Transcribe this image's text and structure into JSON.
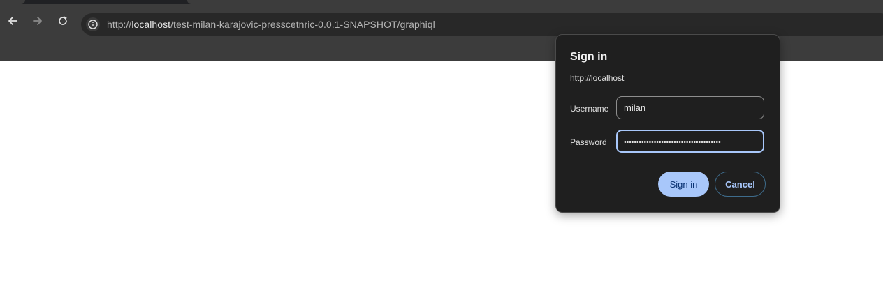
{
  "browser": {
    "url_scheme": "http://",
    "url_host": "localhost",
    "url_path": "/test-milan-karajovic-presscetnric-0.0.1-SNAPSHOT/graphiql",
    "icons": {
      "back": "arrow-left-icon",
      "forward": "arrow-right-icon",
      "reload": "reload-icon",
      "site_info": "info-icon"
    }
  },
  "dialog": {
    "title": "Sign in",
    "origin": "http://localhost",
    "username_label": "Username",
    "username_value": "milan",
    "password_label": "Password",
    "password_value": "•••••••••••••••••••••••••••••••••••••••",
    "sign_in_label": "Sign in",
    "cancel_label": "Cancel"
  },
  "colors": {
    "chrome_bg": "#3c3c3c",
    "omnibox_bg": "#282828",
    "dialog_bg": "#1f1f1f",
    "accent": "#a8c7fa"
  }
}
